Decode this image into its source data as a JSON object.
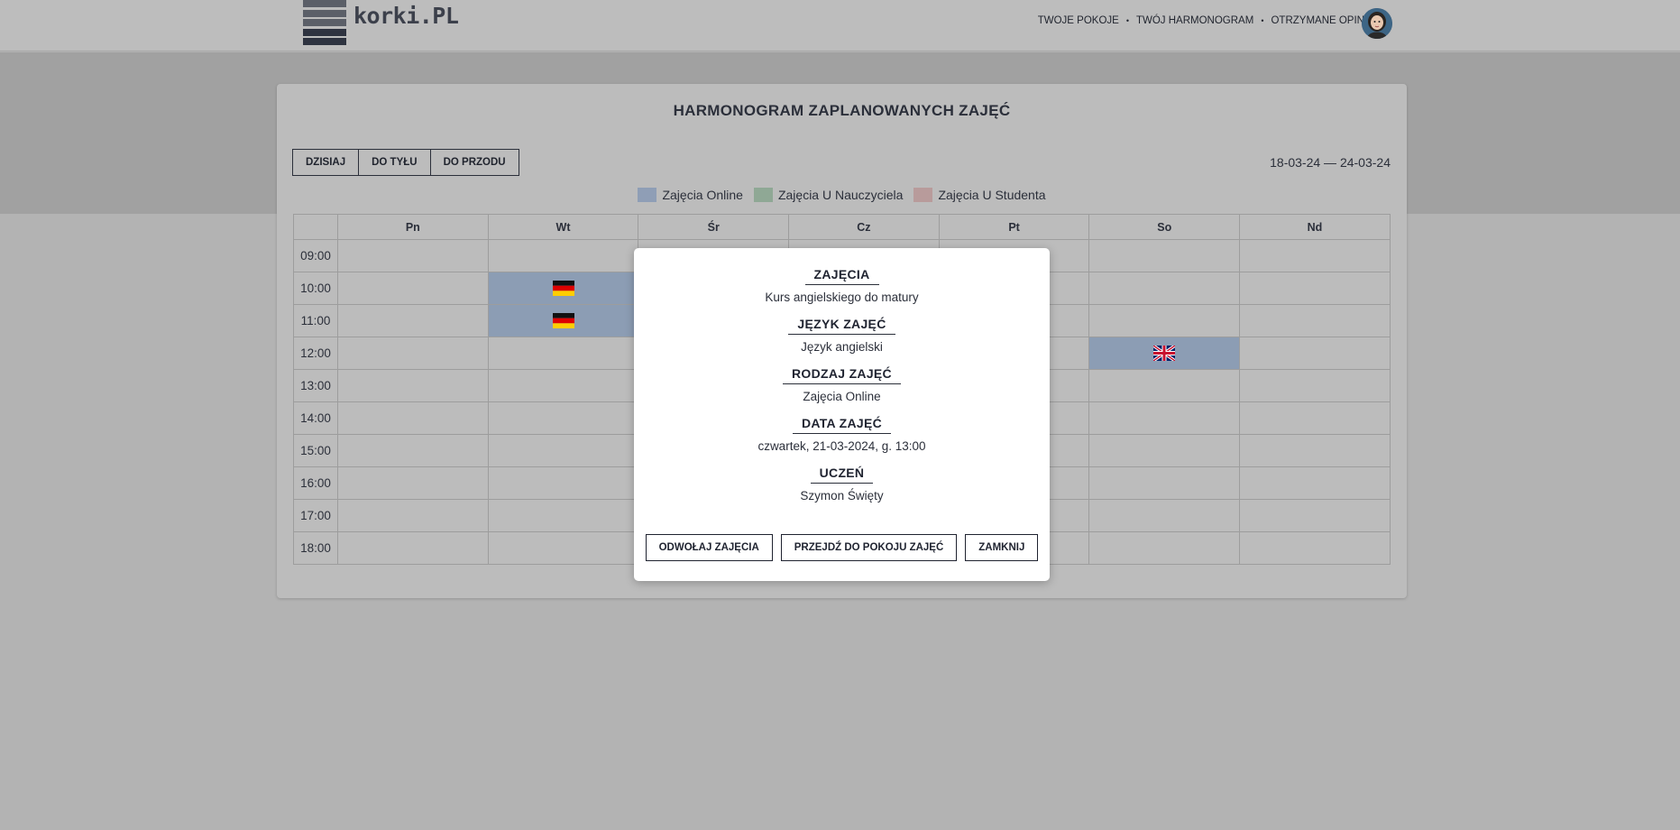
{
  "header": {
    "logo_text": "korki.PL",
    "nav": [
      "TWOJE POKOJE",
      "TWÓJ HARMONOGRAM",
      "OTRZYMANE OPINIE"
    ],
    "separator": "•"
  },
  "schedule": {
    "title": "HARMONOGRAM ZAPLANOWANYCH ZAJĘĆ",
    "buttons": {
      "today": "DZISIAJ",
      "back": "DO TYŁU",
      "forward": "DO PRZODU"
    },
    "date_range": "18-03-24 — 24-03-24",
    "legend": [
      {
        "label": "Zajęcia Online",
        "color": "#8f9eb6"
      },
      {
        "label": "Zajęcia U Nauczyciela",
        "color": "#8fa895"
      },
      {
        "label": "Zajęcia U Studenta",
        "color": "#b89b9b"
      }
    ],
    "days": [
      "Pn",
      "Wt",
      "Śr",
      "Cz",
      "Pt",
      "So",
      "Nd"
    ],
    "hours": [
      "09:00",
      "10:00",
      "11:00",
      "12:00",
      "13:00",
      "14:00",
      "15:00",
      "16:00",
      "17:00",
      "18:00"
    ],
    "events": [
      {
        "day": "Wt",
        "hour": "10:00",
        "type": "online",
        "flag": "germany-flag-icon"
      },
      {
        "day": "Wt",
        "hour": "11:00",
        "type": "online",
        "flag": "germany-flag-icon"
      },
      {
        "day": "So",
        "hour": "12:00",
        "type": "online",
        "flag": "uk-flag-icon"
      }
    ]
  },
  "modal": {
    "sections": [
      {
        "heading": "ZAJĘCIA",
        "value": "Kurs angielskiego do matury"
      },
      {
        "heading": "JĘZYK ZAJĘĆ",
        "value": "Język angielski"
      },
      {
        "heading": "RODZAJ ZAJĘĆ",
        "value": "Zajęcia Online"
      },
      {
        "heading": "DATA ZAJĘĆ",
        "value": "czwartek, 21-03-2024, g. 13:00"
      },
      {
        "heading": "UCZEŃ",
        "value": "Szymon Święty"
      }
    ],
    "buttons": {
      "cancel_class": "ODWOŁAJ ZAJĘCIA",
      "go_to_room": "PRZEJDŹ DO POKOJU ZAJĘĆ",
      "close": "ZAMKNIJ"
    }
  }
}
